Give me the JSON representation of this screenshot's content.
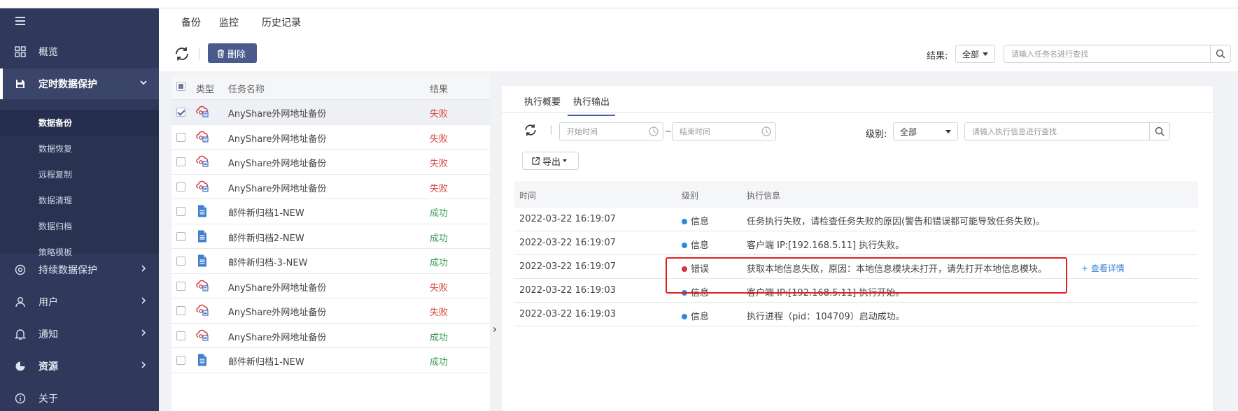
{
  "tabs": [
    "备份",
    "监控",
    "历史记录"
  ],
  "sidebar": {
    "items": [
      {
        "label": "概览",
        "icon": "grid-icon"
      },
      {
        "label": "定时数据保护",
        "icon": "save-icon"
      },
      {
        "label": "持续数据保护",
        "icon": "cd-icon"
      },
      {
        "label": "用户",
        "icon": "user-icon"
      },
      {
        "label": "通知",
        "icon": "bell-icon"
      },
      {
        "label": "资源",
        "icon": "pie-icon"
      },
      {
        "label": "关于",
        "icon": "info-icon"
      }
    ],
    "sub_items": [
      "数据备份",
      "数据恢复",
      "远程复制",
      "数据清理",
      "数据归档",
      "策略模板"
    ]
  },
  "toolbar": {
    "delete_label": "删除",
    "result_label": "结果:",
    "result_value": "全部",
    "search_placeholder": "请输入任务名进行查找"
  },
  "task_table": {
    "headers": [
      "类型",
      "任务名称",
      "结果"
    ],
    "rows": [
      {
        "type": "cloud",
        "name": "AnyShare外网地址备份",
        "result": "失败",
        "status": "fail",
        "checked": true
      },
      {
        "type": "cloud",
        "name": "AnyShare外网地址备份",
        "result": "失败",
        "status": "fail",
        "checked": false
      },
      {
        "type": "cloud",
        "name": "AnyShare外网地址备份",
        "result": "失败",
        "status": "fail",
        "checked": false
      },
      {
        "type": "cloud",
        "name": "AnyShare外网地址备份",
        "result": "失败",
        "status": "fail",
        "checked": false
      },
      {
        "type": "doc",
        "name": "邮件新归档1-NEW",
        "result": "成功",
        "status": "ok",
        "checked": false
      },
      {
        "type": "doc",
        "name": "邮件新归档2-NEW",
        "result": "成功",
        "status": "ok",
        "checked": false
      },
      {
        "type": "doc",
        "name": "邮件新归档-3-NEW",
        "result": "成功",
        "status": "ok",
        "checked": false
      },
      {
        "type": "cloud",
        "name": "AnyShare外网地址备份",
        "result": "失败",
        "status": "fail",
        "checked": false
      },
      {
        "type": "cloud",
        "name": "AnyShare外网地址备份",
        "result": "失败",
        "status": "fail",
        "checked": false
      },
      {
        "type": "cloud",
        "name": "AnyShare外网地址备份",
        "result": "成功",
        "status": "ok",
        "checked": false
      },
      {
        "type": "doc",
        "name": "邮件新归档1-NEW",
        "result": "成功",
        "status": "ok",
        "checked": false
      }
    ]
  },
  "detail": {
    "tabs": [
      "执行概要",
      "执行输出"
    ],
    "start_placeholder": "开始时间",
    "end_placeholder": "结束时间",
    "tilde": "~",
    "level_label": "级别:",
    "level_value": "全部",
    "search_placeholder": "请输入执行信息进行查找",
    "export_label": "导出",
    "headers": [
      "时间",
      "级别",
      "执行信息"
    ],
    "rows": [
      {
        "time": "2022-03-22 16:19:07",
        "level": "信息",
        "kind": "info",
        "message": "任务执行失败，请检查任务失败的原因(警告和错误都可能导致任务失败)。",
        "link": ""
      },
      {
        "time": "2022-03-22 16:19:07",
        "level": "信息",
        "kind": "info",
        "message": "客户端 IP:[192.168.5.11] 执行失败。",
        "link": ""
      },
      {
        "time": "2022-03-22 16:19:07",
        "level": "错误",
        "kind": "err",
        "message": "获取本地信息失败，原因：本地信息模块未打开，请先打开本地信息模块。",
        "link": "+ 查看详情"
      },
      {
        "time": "2022-03-22 16:19:03",
        "level": "信息",
        "kind": "info",
        "message": "客户端 IP:[192.168.5.11] 执行开始。",
        "link": ""
      },
      {
        "time": "2022-03-22 16:19:03",
        "level": "信息",
        "kind": "info",
        "message": "执行进程（pid：104709）启动成功。",
        "link": ""
      }
    ]
  },
  "colors": {
    "sidebar_bg": "#30395c",
    "accent": "#4a5fa8",
    "fail": "#d9463f",
    "success": "#3a9a55",
    "info_dot": "#2f88e0",
    "error_dot": "#dd3333",
    "highlight": "#e02020"
  }
}
